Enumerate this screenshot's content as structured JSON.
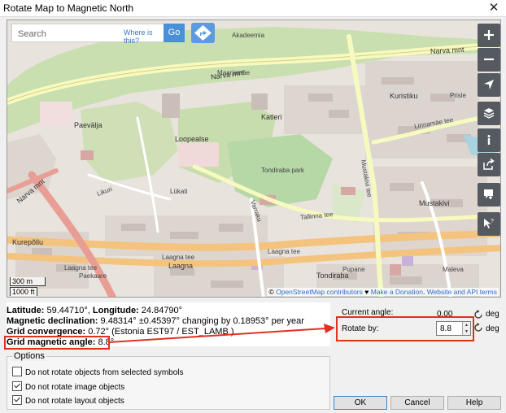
{
  "window": {
    "title": "Rotate Map to Magnetic North",
    "close_glyph": "✕"
  },
  "map": {
    "search": {
      "placeholder": "Search",
      "where_link": "Where is this?",
      "go_label": "Go"
    },
    "scale": {
      "metric": "300 m",
      "imperial": "1000 ft"
    },
    "attribution": {
      "copyright": "© ",
      "osm": "OpenStreetMap contributors",
      "heart": "♥",
      "donate": "Make a Donation",
      "sep": ". ",
      "website": "Website and API terms"
    },
    "labels": [
      {
        "text": "Narva mnt",
        "cls": "big"
      },
      {
        "text": "Narva mnt",
        "cls": "big"
      },
      {
        "text": "Narva mnt",
        "cls": "big"
      },
      {
        "text": "Paevälja",
        "cls": "big"
      },
      {
        "text": "Katleri",
        "cls": "big"
      },
      {
        "text": "Loopealse",
        "cls": "big"
      },
      {
        "text": "Kuristiku",
        "cls": "big"
      },
      {
        "text": "Mustakivi",
        "cls": "big"
      },
      {
        "text": "Tondiraba",
        "cls": "big"
      },
      {
        "text": "Laagna",
        "cls": "big"
      },
      {
        "text": "Kurepõllu",
        "cls": "big"
      },
      {
        "text": "Laagna tee",
        "cls": ""
      },
      {
        "text": "Laagna tee",
        "cls": ""
      },
      {
        "text": "Laagna tee",
        "cls": ""
      },
      {
        "text": "Tallinna tee",
        "cls": ""
      },
      {
        "text": "Mustakivi tee",
        "cls": ""
      },
      {
        "text": "Linnamäe tee",
        "cls": ""
      },
      {
        "text": "Maarjamäe",
        "cls": ""
      },
      {
        "text": "Tondiraba park",
        "cls": ""
      },
      {
        "text": "Pupane",
        "cls": ""
      },
      {
        "text": "Maleva",
        "cls": ""
      },
      {
        "text": "Akadeemia",
        "cls": ""
      },
      {
        "text": "Prisle",
        "cls": ""
      },
      {
        "text": "Paekaare",
        "cls": ""
      },
      {
        "text": "Likuri",
        "cls": ""
      },
      {
        "text": "Varraku",
        "cls": ""
      },
      {
        "text": "Lükati",
        "cls": ""
      }
    ],
    "toolbar": [
      "zoom-in-icon",
      "zoom-out-icon",
      "locate-icon",
      "layers-icon",
      "info-icon",
      "share-icon",
      "comment-icon",
      "query-icon"
    ]
  },
  "info": {
    "latitude_label": "Latitude:",
    "latitude_value": " 59.44710°, ",
    "longitude_label": "Longitude:",
    "longitude_value": " 24.84790°",
    "declination_label": "Magnetic declination:",
    "declination_value": " 9.48314° ±0.45397° changing by 0.18953° per year",
    "convergence_label": "Grid convergence:",
    "convergence_value": " 0.72° (Estonia EST97 / EST_LAMB  )",
    "grid_angle_label": "Grid magnetic angle:",
    "grid_angle_value": " 8.8°"
  },
  "options": {
    "legend": "Options",
    "items": [
      {
        "label": "Do not rotate objects from selected symbols",
        "checked": false
      },
      {
        "label": "Do not rotate image objects",
        "checked": true
      },
      {
        "label": "Do not rotate layout objects",
        "checked": true
      }
    ]
  },
  "rotation": {
    "current_label": "Current angle:",
    "current_value": "0.00",
    "deg_unit": "deg",
    "rotate_label": "Rotate by:",
    "rotate_value": "8.8"
  },
  "buttons": {
    "ok": "OK",
    "cancel": "Cancel",
    "help": "Help"
  },
  "colors": {
    "highlight": "#e0311f",
    "primary": "#4a90d9"
  }
}
